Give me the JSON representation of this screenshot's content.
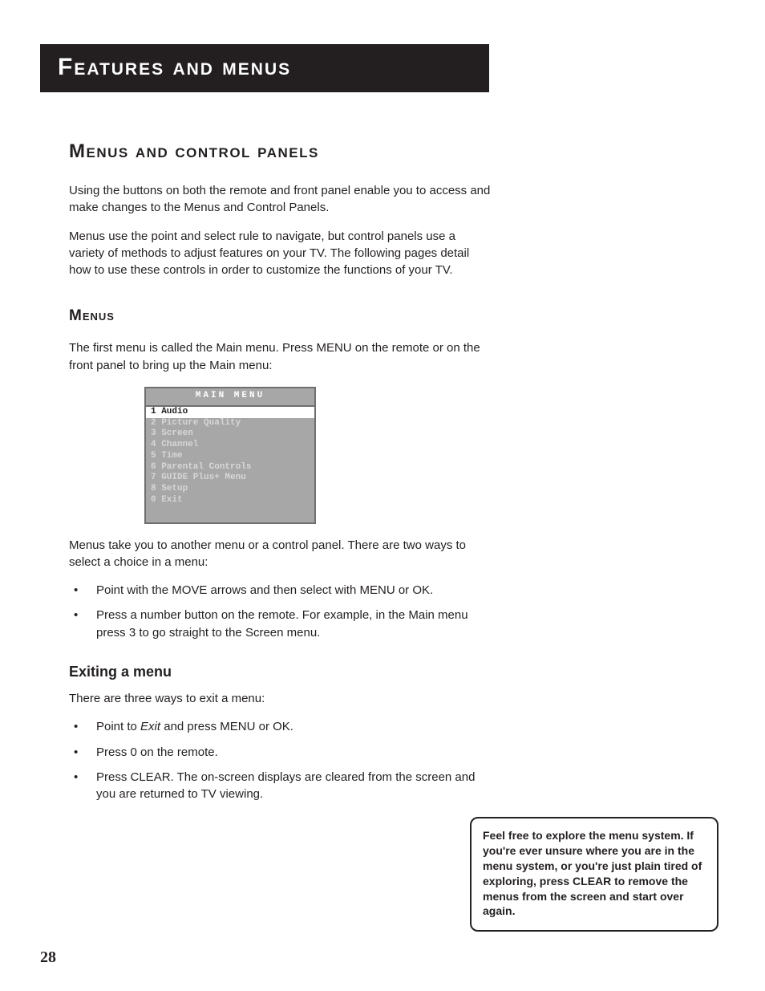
{
  "header": {
    "chapter_title": "Features and Menus"
  },
  "section": {
    "title": "Menus and Control Panels",
    "para1": "Using the buttons on both the remote and front panel enable you to access and make changes to the Menus and Control Panels.",
    "para2": "Menus use the point and select rule to navigate, but control panels use a variety of methods to adjust features on your TV. The following pages detail how to use these controls in order to customize the functions of your TV."
  },
  "menus": {
    "title": "Menus",
    "intro": "The first menu is called the Main menu. Press MENU on the remote or on the front panel to bring up the Main menu:",
    "graphic": {
      "title": "MAIN MENU",
      "items": [
        {
          "num": "1",
          "label": "Audio",
          "selected": true
        },
        {
          "num": "2",
          "label": "Picture Quality",
          "selected": false
        },
        {
          "num": "3",
          "label": "Screen",
          "selected": false
        },
        {
          "num": "4",
          "label": "Channel",
          "selected": false
        },
        {
          "num": "5",
          "label": "Time",
          "selected": false
        },
        {
          "num": "6",
          "label": "Parental Controls",
          "selected": false
        },
        {
          "num": "7",
          "label": "GUIDE Plus+ Menu",
          "selected": false
        },
        {
          "num": "8",
          "label": "Setup",
          "selected": false
        },
        {
          "num": "0",
          "label": "Exit",
          "selected": false
        }
      ]
    },
    "after_graphic": "Menus take you to another menu or a control panel. There are two ways to select a choice in a menu:",
    "select_bullets": [
      "Point with the MOVE arrows and then select with MENU or OK.",
      "Press a number button on the remote. For example, in the Main menu press 3 to go straight to the Screen menu."
    ]
  },
  "exiting": {
    "title": "Exiting a menu",
    "intro": "There are three ways to exit a menu:",
    "bullets_pre0": "Point to ",
    "bullets_em0": "Exit",
    "bullets_post0": " and press MENU or OK.",
    "bullets_1": "Press 0 on the remote.",
    "bullets_2": "Press CLEAR. The on-screen displays are cleared from the screen and you are returned to TV viewing."
  },
  "tip": "Feel free to explore the menu system. If you're ever unsure where you are in the menu system, or you're just plain tired of exploring, press CLEAR to remove the menus from the screen and start over again.",
  "page_number": "28"
}
